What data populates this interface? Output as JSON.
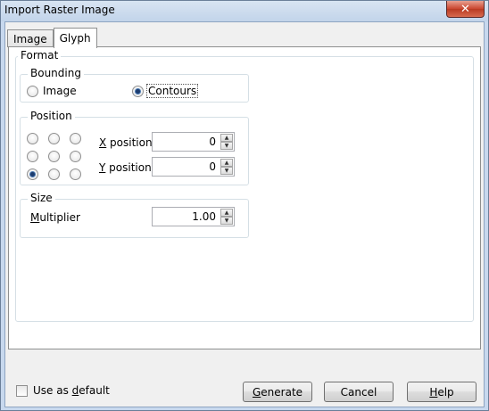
{
  "window": {
    "title": "Import Raster Image",
    "close_label": "✕"
  },
  "tabs": [
    {
      "label": "Image",
      "active": false
    },
    {
      "label": "Glyph",
      "active": true
    }
  ],
  "format": {
    "label": "Format",
    "bounding": {
      "label": "Bounding",
      "options": [
        {
          "label": "Image",
          "checked": false
        },
        {
          "label": "Contours",
          "checked": true
        }
      ]
    },
    "position": {
      "label": "Position",
      "selected_anchor": "bottom-left",
      "x_label_key": "X",
      "x_label_rest": " position",
      "x_value": "0",
      "y_label_key": "Y",
      "y_label_rest": " position",
      "y_value": "0"
    },
    "size": {
      "label": "Size",
      "multiplier_key": "M",
      "multiplier_rest": "ultiplier",
      "multiplier_value": "1.00"
    }
  },
  "footer": {
    "use_default_pre": "Use as ",
    "use_default_key": "d",
    "use_default_rest": "efault",
    "use_default_checked": false,
    "generate_key": "G",
    "generate_rest": "enerate",
    "cancel_label": "Cancel",
    "help_key": "H",
    "help_rest": "elp"
  }
}
